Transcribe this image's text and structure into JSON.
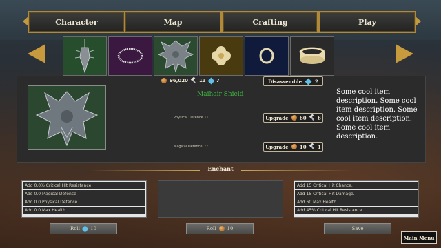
{
  "tabs": [
    {
      "label": "Character"
    },
    {
      "label": "Map"
    },
    {
      "label": "Crafting"
    },
    {
      "label": "Play"
    }
  ],
  "items": [
    {
      "icon": "spiked-amulet-icon",
      "bg": "#264d2c"
    },
    {
      "icon": "bead-necklace-icon",
      "bg": "#3a1840"
    },
    {
      "icon": "dragon-shield-icon",
      "bg": "#2b4a30"
    },
    {
      "icon": "gold-flower-icon",
      "bg": "#4a3a10"
    },
    {
      "icon": "gold-ring-icon",
      "bg": "#101a3a"
    },
    {
      "icon": "gold-bracelet-icon",
      "bg": "#2a2a2a"
    }
  ],
  "resources": {
    "gold": "96,020",
    "hammers": "13",
    "gems": "7"
  },
  "disassemble": {
    "label": "Disassemble",
    "gems": "2"
  },
  "item": {
    "name": "Maihair Shield",
    "physical_label": "Physical Defence",
    "physical_value": "33",
    "magical_label": "Magical Defence",
    "magical_value": "22",
    "description": "Some cool item description. Some cool item description. Some cool item description. Some cool item description."
  },
  "upgrade_physical": {
    "label": "Upgrade",
    "gold": "60",
    "hammers": "6"
  },
  "upgrade_magical": {
    "label": "Upgrade",
    "gold": "10",
    "hammers": "1"
  },
  "enchant": {
    "title": "Enchant",
    "left_list": [
      "Add 0.0% Critical Hit Resistance",
      "Add 0.0 Magical Defence",
      "Add 0.0 Physical Defence",
      "Add 0.0 Max Health"
    ],
    "right_list": [
      "Add 15 Critical Hit Chance.",
      "Add 15  Critical Hit Damage.",
      "Add 60 Max Health",
      "Add 45% Critical Hit Resistance"
    ]
  },
  "bottom": {
    "roll_gem_label": "Roll",
    "roll_gem_cost": "10",
    "roll_gold_label": "Roll",
    "roll_gold_cost": "10",
    "save_label": "Save"
  },
  "main_menu_label": "Main Menu",
  "colors": {
    "gold_border": "#b08a3a",
    "item_name": "#3fae3f",
    "gem": "#5fc0e8"
  }
}
